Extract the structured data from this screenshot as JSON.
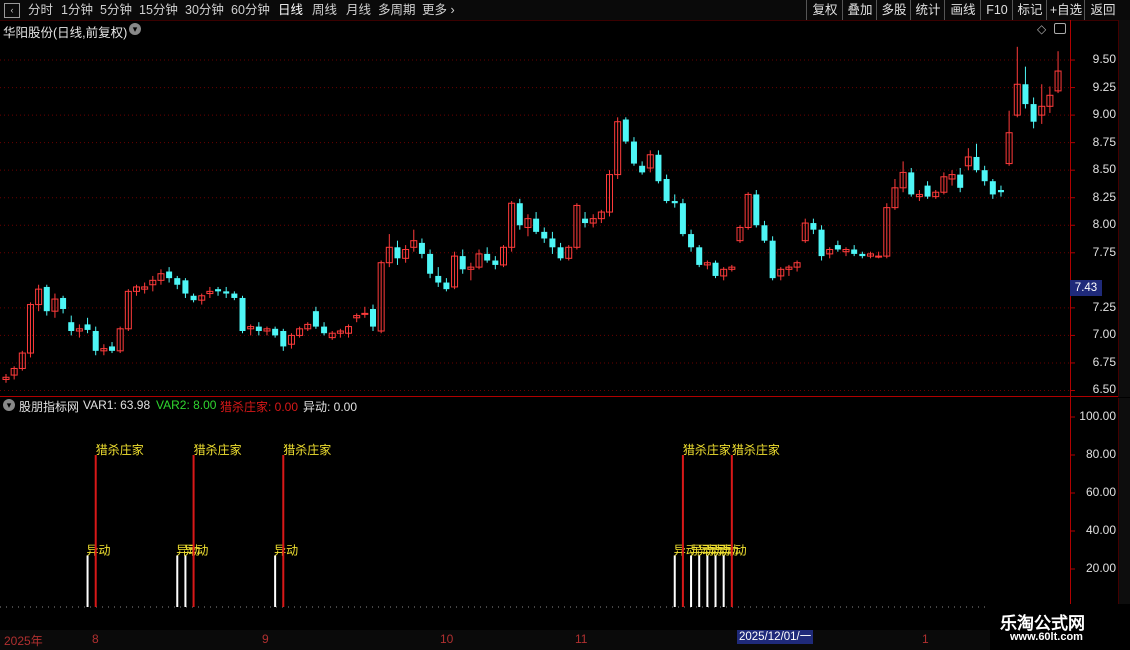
{
  "toolbar": {
    "periods": [
      "分时",
      "1分钟",
      "5分钟",
      "15分钟",
      "30分钟",
      "60分钟",
      "日线",
      "周线",
      "月线",
      "多周期",
      "更多"
    ],
    "active_period": "日线",
    "right_buttons": [
      "复权",
      "叠加",
      "多股",
      "统计",
      "画线",
      "F10",
      "标记",
      "+自选",
      "返回"
    ]
  },
  "chart_title": "华阳股份(日线,前复权)",
  "current_price_label": "7.43",
  "price_axis_labels": [
    "9.50",
    "9.25",
    "9.00",
    "8.75",
    "8.50",
    "8.25",
    "8.00",
    "7.75",
    "7.25",
    "7.00",
    "6.75",
    "6.50"
  ],
  "indicator": {
    "name": "股朋指标网",
    "var1": "VAR1: 63.98",
    "var2": "VAR2: 8.00",
    "liesha": "猎杀庄家: 0.00",
    "yidong": "异动: 0.00",
    "axis_labels": [
      "100.00",
      "80.00",
      "60.00",
      "40.00",
      "20.00"
    ]
  },
  "date_labels": [
    "2025年",
    "8",
    "9",
    "10",
    "11",
    "1"
  ],
  "date_cursor": "2025/12/01/一",
  "watermark": {
    "name": "乐淘公式网",
    "url": "www.60lt.com"
  },
  "colors": {
    "up": "#ff3b3b",
    "down": "#4ef6f6",
    "signal_red": "#d81818",
    "signal_white": "#ffffff",
    "label_yellow": "#f0e030",
    "grid": "#6a0000"
  },
  "chart_data": {
    "type": "candlestick",
    "price_ylim": [
      6.45,
      9.7
    ],
    "candles": [
      {
        "o": 6.6,
        "h": 6.65,
        "l": 6.57,
        "c": 6.62
      },
      {
        "o": 6.64,
        "h": 6.72,
        "l": 6.6,
        "c": 6.7
      },
      {
        "o": 6.7,
        "h": 6.86,
        "l": 6.68,
        "c": 6.84
      },
      {
        "o": 6.84,
        "h": 7.3,
        "l": 6.8,
        "c": 7.28
      },
      {
        "o": 7.28,
        "h": 7.46,
        "l": 7.22,
        "c": 7.42
      },
      {
        "o": 7.44,
        "h": 7.46,
        "l": 7.18,
        "c": 7.22
      },
      {
        "o": 7.22,
        "h": 7.38,
        "l": 7.16,
        "c": 7.33
      },
      {
        "o": 7.34,
        "h": 7.36,
        "l": 7.2,
        "c": 7.24
      },
      {
        "o": 7.12,
        "h": 7.18,
        "l": 7.0,
        "c": 7.04
      },
      {
        "o": 7.04,
        "h": 7.1,
        "l": 6.98,
        "c": 7.06
      },
      {
        "o": 7.1,
        "h": 7.16,
        "l": 7.02,
        "c": 7.05
      },
      {
        "o": 7.04,
        "h": 7.08,
        "l": 6.82,
        "c": 6.86
      },
      {
        "o": 6.86,
        "h": 6.92,
        "l": 6.82,
        "c": 6.88
      },
      {
        "o": 6.9,
        "h": 6.94,
        "l": 6.84,
        "c": 6.86
      },
      {
        "o": 6.86,
        "h": 7.08,
        "l": 6.84,
        "c": 7.06
      },
      {
        "o": 7.06,
        "h": 7.42,
        "l": 7.04,
        "c": 7.4
      },
      {
        "o": 7.4,
        "h": 7.46,
        "l": 7.36,
        "c": 7.44
      },
      {
        "o": 7.42,
        "h": 7.48,
        "l": 7.38,
        "c": 7.44
      },
      {
        "o": 7.46,
        "h": 7.54,
        "l": 7.4,
        "c": 7.5
      },
      {
        "o": 7.5,
        "h": 7.6,
        "l": 7.46,
        "c": 7.56
      },
      {
        "o": 7.58,
        "h": 7.62,
        "l": 7.48,
        "c": 7.52
      },
      {
        "o": 7.52,
        "h": 7.54,
        "l": 7.42,
        "c": 7.46
      },
      {
        "o": 7.5,
        "h": 7.52,
        "l": 7.34,
        "c": 7.38
      },
      {
        "o": 7.36,
        "h": 7.38,
        "l": 7.3,
        "c": 7.32
      },
      {
        "o": 7.32,
        "h": 7.38,
        "l": 7.28,
        "c": 7.36
      },
      {
        "o": 7.38,
        "h": 7.44,
        "l": 7.34,
        "c": 7.4
      },
      {
        "o": 7.42,
        "h": 7.44,
        "l": 7.36,
        "c": 7.4
      },
      {
        "o": 7.4,
        "h": 7.44,
        "l": 7.34,
        "c": 7.38
      },
      {
        "o": 7.38,
        "h": 7.4,
        "l": 7.32,
        "c": 7.34
      },
      {
        "o": 7.34,
        "h": 7.36,
        "l": 7.02,
        "c": 7.04
      },
      {
        "o": 7.06,
        "h": 7.1,
        "l": 7.0,
        "c": 7.08
      },
      {
        "o": 7.08,
        "h": 7.12,
        "l": 7.0,
        "c": 7.04
      },
      {
        "o": 7.04,
        "h": 7.08,
        "l": 7.0,
        "c": 7.06
      },
      {
        "o": 7.06,
        "h": 7.08,
        "l": 6.98,
        "c": 7.0
      },
      {
        "o": 7.04,
        "h": 7.06,
        "l": 6.86,
        "c": 6.9
      },
      {
        "o": 6.92,
        "h": 7.02,
        "l": 6.88,
        "c": 7.0
      },
      {
        "o": 7.0,
        "h": 7.08,
        "l": 6.98,
        "c": 7.06
      },
      {
        "o": 7.06,
        "h": 7.12,
        "l": 7.04,
        "c": 7.1
      },
      {
        "o": 7.22,
        "h": 7.26,
        "l": 7.06,
        "c": 7.08
      },
      {
        "o": 7.08,
        "h": 7.12,
        "l": 7.0,
        "c": 7.02
      },
      {
        "o": 6.98,
        "h": 7.04,
        "l": 6.96,
        "c": 7.02
      },
      {
        "o": 7.02,
        "h": 7.06,
        "l": 6.98,
        "c": 7.04
      },
      {
        "o": 7.02,
        "h": 7.1,
        "l": 6.98,
        "c": 7.08
      },
      {
        "o": 7.16,
        "h": 7.2,
        "l": 7.12,
        "c": 7.18
      },
      {
        "o": 7.2,
        "h": 7.26,
        "l": 7.16,
        "c": 7.2
      },
      {
        "o": 7.24,
        "h": 7.28,
        "l": 7.04,
        "c": 7.08
      },
      {
        "o": 7.04,
        "h": 7.68,
        "l": 7.02,
        "c": 7.66
      },
      {
        "o": 7.66,
        "h": 7.92,
        "l": 7.62,
        "c": 7.8
      },
      {
        "o": 7.8,
        "h": 7.86,
        "l": 7.64,
        "c": 7.7
      },
      {
        "o": 7.7,
        "h": 7.82,
        "l": 7.66,
        "c": 7.78
      },
      {
        "o": 7.8,
        "h": 7.96,
        "l": 7.76,
        "c": 7.86
      },
      {
        "o": 7.84,
        "h": 7.88,
        "l": 7.7,
        "c": 7.74
      },
      {
        "o": 7.74,
        "h": 7.78,
        "l": 7.52,
        "c": 7.56
      },
      {
        "o": 7.54,
        "h": 7.62,
        "l": 7.44,
        "c": 7.48
      },
      {
        "o": 7.48,
        "h": 7.52,
        "l": 7.4,
        "c": 7.42
      },
      {
        "o": 7.44,
        "h": 7.76,
        "l": 7.42,
        "c": 7.72
      },
      {
        "o": 7.72,
        "h": 7.78,
        "l": 7.56,
        "c": 7.6
      },
      {
        "o": 7.6,
        "h": 7.66,
        "l": 7.5,
        "c": 7.62
      },
      {
        "o": 7.62,
        "h": 7.78,
        "l": 7.6,
        "c": 7.74
      },
      {
        "o": 7.74,
        "h": 7.8,
        "l": 7.66,
        "c": 7.68
      },
      {
        "o": 7.68,
        "h": 7.72,
        "l": 7.6,
        "c": 7.64
      },
      {
        "o": 7.64,
        "h": 7.82,
        "l": 7.62,
        "c": 7.8
      },
      {
        "o": 7.8,
        "h": 8.22,
        "l": 7.76,
        "c": 8.2
      },
      {
        "o": 8.2,
        "h": 8.24,
        "l": 7.96,
        "c": 8.0
      },
      {
        "o": 7.98,
        "h": 8.1,
        "l": 7.9,
        "c": 8.06
      },
      {
        "o": 8.06,
        "h": 8.12,
        "l": 7.92,
        "c": 7.94
      },
      {
        "o": 7.94,
        "h": 7.98,
        "l": 7.84,
        "c": 7.88
      },
      {
        "o": 7.88,
        "h": 7.94,
        "l": 7.74,
        "c": 7.8
      },
      {
        "o": 7.8,
        "h": 7.84,
        "l": 7.68,
        "c": 7.7
      },
      {
        "o": 7.7,
        "h": 7.82,
        "l": 7.68,
        "c": 7.8
      },
      {
        "o": 7.8,
        "h": 8.2,
        "l": 7.78,
        "c": 8.18
      },
      {
        "o": 8.06,
        "h": 8.12,
        "l": 7.98,
        "c": 8.02
      },
      {
        "o": 8.02,
        "h": 8.1,
        "l": 7.98,
        "c": 8.06
      },
      {
        "o": 8.06,
        "h": 8.14,
        "l": 8.02,
        "c": 8.12
      },
      {
        "o": 8.12,
        "h": 8.5,
        "l": 8.08,
        "c": 8.46
      },
      {
        "o": 8.46,
        "h": 8.98,
        "l": 8.42,
        "c": 8.94
      },
      {
        "o": 8.96,
        "h": 8.98,
        "l": 8.74,
        "c": 8.76
      },
      {
        "o": 8.76,
        "h": 8.8,
        "l": 8.54,
        "c": 8.56
      },
      {
        "o": 8.54,
        "h": 8.58,
        "l": 8.46,
        "c": 8.48
      },
      {
        "o": 8.52,
        "h": 8.68,
        "l": 8.48,
        "c": 8.64
      },
      {
        "o": 8.64,
        "h": 8.68,
        "l": 8.38,
        "c": 8.4
      },
      {
        "o": 8.42,
        "h": 8.46,
        "l": 8.2,
        "c": 8.22
      },
      {
        "o": 8.22,
        "h": 8.28,
        "l": 8.16,
        "c": 8.2
      },
      {
        "o": 8.2,
        "h": 8.24,
        "l": 7.9,
        "c": 7.92
      },
      {
        "o": 7.92,
        "h": 7.96,
        "l": 7.76,
        "c": 7.8
      },
      {
        "o": 7.8,
        "h": 7.82,
        "l": 7.62,
        "c": 7.64
      },
      {
        "o": 7.64,
        "h": 7.68,
        "l": 7.6,
        "c": 7.66
      },
      {
        "o": 7.66,
        "h": 7.68,
        "l": 7.52,
        "c": 7.54
      },
      {
        "o": 7.54,
        "h": 7.62,
        "l": 7.5,
        "c": 7.6
      },
      {
        "o": 7.6,
        "h": 7.64,
        "l": 7.58,
        "c": 7.62
      },
      {
        "o": 7.86,
        "h": 8.0,
        "l": 7.84,
        "c": 7.98
      },
      {
        "o": 7.98,
        "h": 8.3,
        "l": 7.96,
        "c": 8.28
      },
      {
        "o": 8.28,
        "h": 8.32,
        "l": 7.98,
        "c": 8.0
      },
      {
        "o": 8.0,
        "h": 8.04,
        "l": 7.84,
        "c": 7.86
      },
      {
        "o": 7.86,
        "h": 7.9,
        "l": 7.5,
        "c": 7.52
      },
      {
        "o": 7.54,
        "h": 7.62,
        "l": 7.5,
        "c": 7.6
      },
      {
        "o": 7.6,
        "h": 7.64,
        "l": 7.54,
        "c": 7.62
      },
      {
        "o": 7.62,
        "h": 7.68,
        "l": 7.58,
        "c": 7.66
      },
      {
        "o": 7.86,
        "h": 8.06,
        "l": 7.84,
        "c": 8.02
      },
      {
        "o": 8.02,
        "h": 8.06,
        "l": 7.92,
        "c": 7.96
      },
      {
        "o": 7.96,
        "h": 8.0,
        "l": 7.68,
        "c": 7.72
      },
      {
        "o": 7.74,
        "h": 7.8,
        "l": 7.7,
        "c": 7.78
      },
      {
        "o": 7.82,
        "h": 7.86,
        "l": 7.76,
        "c": 7.78
      },
      {
        "o": 7.76,
        "h": 7.8,
        "l": 7.72,
        "c": 7.78
      },
      {
        "o": 7.78,
        "h": 7.82,
        "l": 7.72,
        "c": 7.74
      },
      {
        "o": 7.74,
        "h": 7.76,
        "l": 7.7,
        "c": 7.72
      },
      {
        "o": 7.72,
        "h": 7.76,
        "l": 7.7,
        "c": 7.74
      },
      {
        "o": 7.72,
        "h": 7.76,
        "l": 7.7,
        "c": 7.72
      },
      {
        "o": 7.72,
        "h": 8.2,
        "l": 7.7,
        "c": 8.16
      },
      {
        "o": 8.16,
        "h": 8.42,
        "l": 8.14,
        "c": 8.34
      },
      {
        "o": 8.34,
        "h": 8.58,
        "l": 8.3,
        "c": 8.48
      },
      {
        "o": 8.48,
        "h": 8.52,
        "l": 8.26,
        "c": 8.28
      },
      {
        "o": 8.26,
        "h": 8.32,
        "l": 8.22,
        "c": 8.28
      },
      {
        "o": 8.36,
        "h": 8.4,
        "l": 8.24,
        "c": 8.26
      },
      {
        "o": 8.26,
        "h": 8.32,
        "l": 8.24,
        "c": 8.3
      },
      {
        "o": 8.3,
        "h": 8.48,
        "l": 8.28,
        "c": 8.44
      },
      {
        "o": 8.42,
        "h": 8.5,
        "l": 8.36,
        "c": 8.46
      },
      {
        "o": 8.46,
        "h": 8.52,
        "l": 8.3,
        "c": 8.34
      },
      {
        "o": 8.54,
        "h": 8.7,
        "l": 8.5,
        "c": 8.62
      },
      {
        "o": 8.62,
        "h": 8.74,
        "l": 8.48,
        "c": 8.5
      },
      {
        "o": 8.5,
        "h": 8.54,
        "l": 8.36,
        "c": 8.4
      },
      {
        "o": 8.4,
        "h": 8.42,
        "l": 8.24,
        "c": 8.28
      },
      {
        "o": 8.32,
        "h": 8.36,
        "l": 8.26,
        "c": 8.3
      },
      {
        "o": 8.56,
        "h": 9.04,
        "l": 8.54,
        "c": 8.84
      },
      {
        "o": 9.0,
        "h": 9.62,
        "l": 8.98,
        "c": 9.28
      },
      {
        "o": 9.28,
        "h": 9.44,
        "l": 9.06,
        "c": 9.1
      },
      {
        "o": 9.1,
        "h": 9.16,
        "l": 8.88,
        "c": 8.94
      },
      {
        "o": 9.0,
        "h": 9.28,
        "l": 8.92,
        "c": 9.08
      },
      {
        "o": 9.08,
        "h": 9.26,
        "l": 9.02,
        "c": 9.18
      },
      {
        "o": 9.22,
        "h": 9.58,
        "l": 9.2,
        "c": 9.4
      }
    ],
    "indicator_ylim": [
      0,
      110
    ],
    "liesha_signal_index": [
      11,
      23,
      34,
      83,
      89
    ],
    "liesha_value": 80,
    "yidong_signal_index": [
      10,
      21,
      22,
      33,
      82,
      84,
      85,
      86,
      87,
      88
    ],
    "yidong_value": 25
  }
}
